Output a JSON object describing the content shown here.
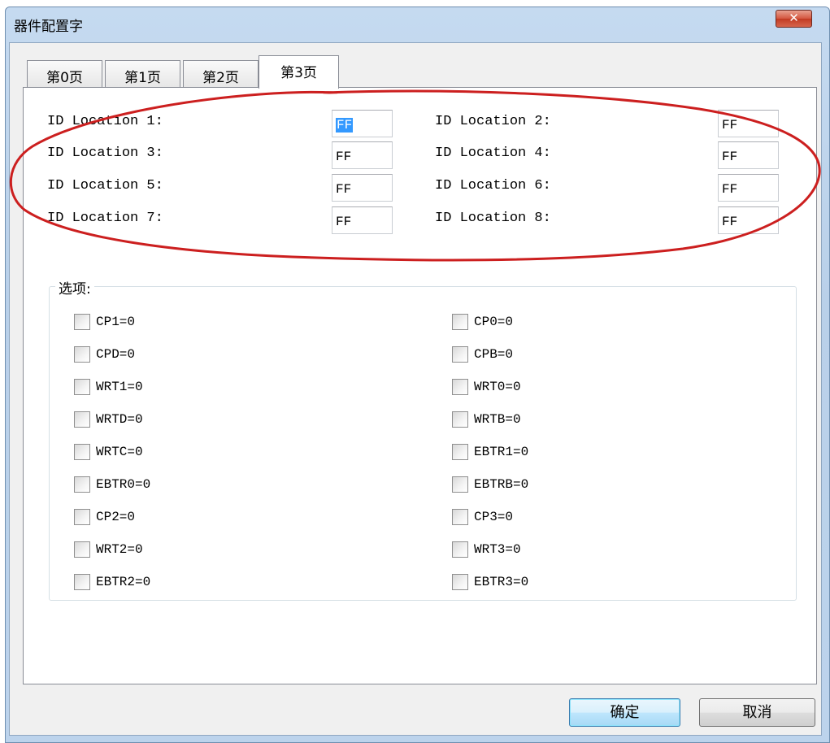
{
  "window": {
    "title": "器件配置字",
    "close_label": "✕"
  },
  "tabs": [
    {
      "label": "第0页"
    },
    {
      "label": "第1页"
    },
    {
      "label": "第2页"
    },
    {
      "label": "第3页"
    }
  ],
  "active_tab_index": 3,
  "id_locations": [
    {
      "label": "ID Location 1:",
      "value": "FF",
      "selected": true
    },
    {
      "label": "ID Location 2:",
      "value": "FF"
    },
    {
      "label": "ID Location 3:",
      "value": "FF"
    },
    {
      "label": "ID Location 4:",
      "value": "FF"
    },
    {
      "label": "ID Location 5:",
      "value": "FF"
    },
    {
      "label": "ID Location 6:",
      "value": "FF"
    },
    {
      "label": "ID Location 7:",
      "value": "FF"
    },
    {
      "label": "ID Location 8:",
      "value": "FF"
    }
  ],
  "options": {
    "title": "选项:",
    "left": [
      "CP1=0",
      "CPD=0",
      "WRT1=0",
      "WRTD=0",
      "WRTC=0",
      "EBTR0=0",
      "CP2=0",
      "WRT2=0",
      "EBTR2=0"
    ],
    "right": [
      "CP0=0",
      "CPB=0",
      "WRT0=0",
      "WRTB=0",
      "EBTR1=0",
      "EBTRB=0",
      "CP3=0",
      "WRT3=0",
      "EBTR3=0"
    ]
  },
  "buttons": {
    "ok": "确定",
    "cancel": "取消"
  },
  "annotation": {
    "color": "#cc1f1f"
  }
}
